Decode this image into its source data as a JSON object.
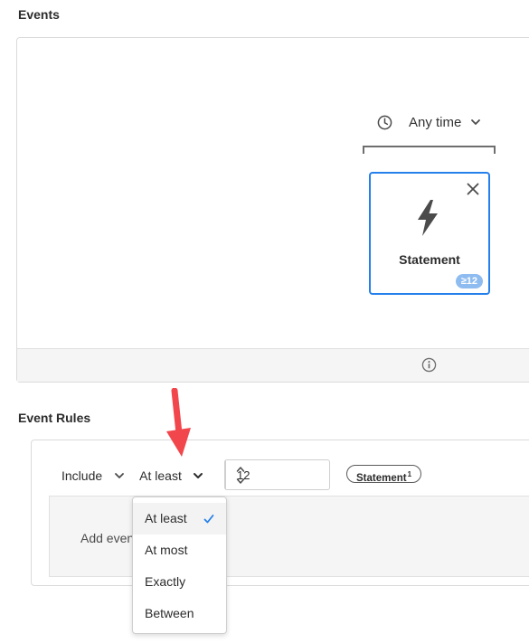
{
  "events_section": {
    "title": "Events",
    "time_selector": {
      "label": "Any time",
      "icon": "clock-icon"
    },
    "event_card": {
      "name": "Statement",
      "icon": "lightning-bolt-icon",
      "badge": "≥12"
    },
    "footer_icon": "info-icon"
  },
  "rules_section": {
    "title": "Event Rules",
    "include_dropdown": "Include",
    "comparator_dropdown": "At least",
    "count_value": "12",
    "tag": {
      "label": "Statement",
      "superscript": "1"
    },
    "add_event_text": "Add even"
  },
  "dropdown_menu": {
    "items": [
      {
        "label": "At least",
        "selected": true
      },
      {
        "label": "At most",
        "selected": false
      },
      {
        "label": "Exactly",
        "selected": false
      },
      {
        "label": "Between",
        "selected": false
      }
    ]
  },
  "colors": {
    "accent": "#2680eb",
    "badge_bg": "#8fbcf0",
    "annotation_arrow": "#f1464b",
    "check": "#2680eb"
  }
}
